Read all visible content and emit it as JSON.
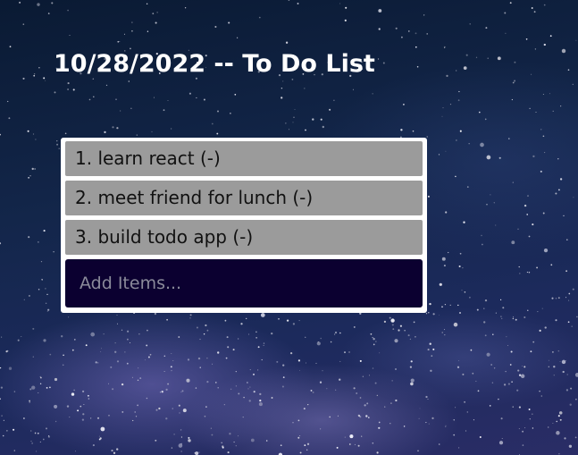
{
  "header": {
    "title": "10/28/2022 -- To Do List"
  },
  "todos": [
    {
      "label": "1. learn react (-)"
    },
    {
      "label": "2. meet friend for lunch (-)"
    },
    {
      "label": "3. build todo app (-)"
    }
  ],
  "add_input": {
    "value": "",
    "placeholder": "Add Items..."
  },
  "colors": {
    "item_bg": "#9b9b9b",
    "input_bg": "#0b0030",
    "card_bg": "#ffffff",
    "title_color": "#ffffff"
  }
}
